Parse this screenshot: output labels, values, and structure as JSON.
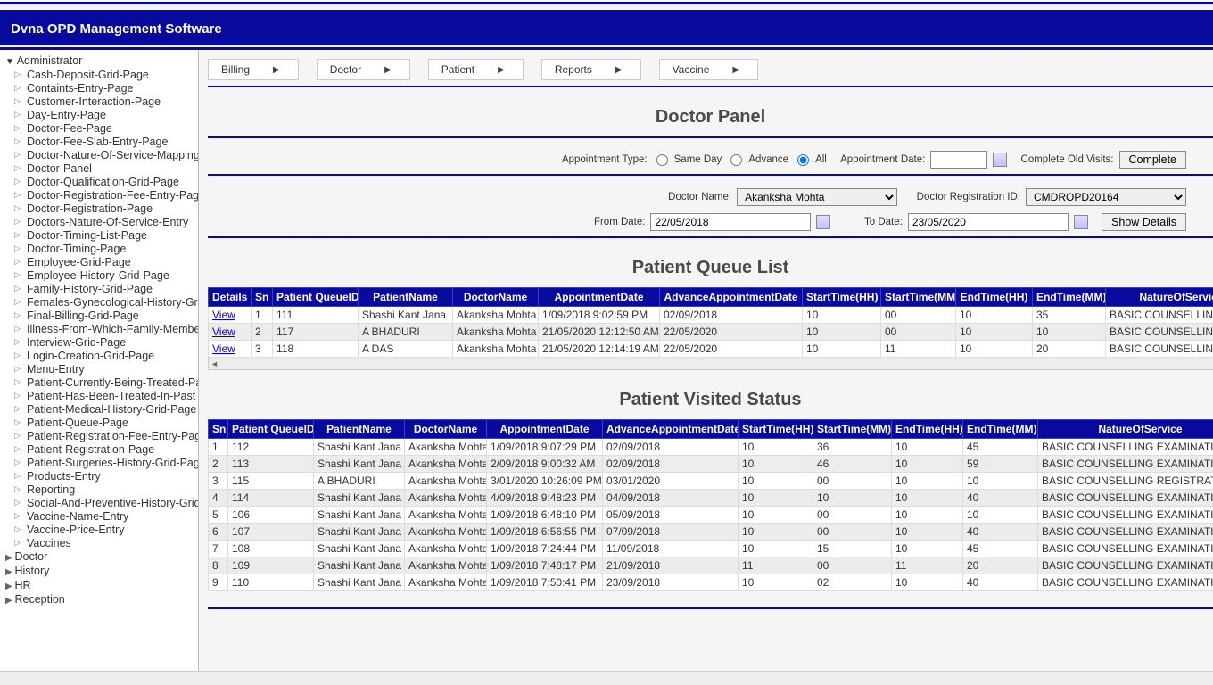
{
  "header": {
    "title": "Dvna OPD Management Software"
  },
  "sidebar": {
    "root": "Administrator",
    "items": [
      "Cash-Deposit-Grid-Page",
      "Containts-Entry-Page",
      "Customer-Interaction-Page",
      "Day-Entry-Page",
      "Doctor-Fee-Page",
      "Doctor-Fee-Slab-Entry-Page",
      "Doctor-Nature-Of-Service-Mapping",
      "Doctor-Panel",
      "Doctor-Qualification-Grid-Page",
      "Doctor-Registration-Fee-Entry-Page",
      "Doctor-Registration-Page",
      "Doctors-Nature-Of-Service-Entry",
      "Doctor-Timing-List-Page",
      "Doctor-Timing-Page",
      "Employee-Grid-Page",
      "Employee-History-Grid-Page",
      "Family-History-Grid-Page",
      "Females-Gynecological-History-Grid",
      "Final-Billing-Grid-Page",
      "Illness-From-Which-Family-Members",
      "Interview-Grid-Page",
      "Login-Creation-Grid-Page",
      "Menu-Entry",
      "Patient-Currently-Being-Treated-Page",
      "Patient-Has-Been-Treated-In-Past",
      "Patient-Medical-History-Grid-Page",
      "Patient-Queue-Page",
      "Patient-Registration-Fee-Entry-Page",
      "Patient-Registration-Page",
      "Patient-Surgeries-History-Grid-Page",
      "Products-Entry",
      "Reporting",
      "Social-And-Preventive-History-Grid",
      "Vaccine-Name-Entry",
      "Vaccine-Price-Entry",
      "Vaccines"
    ],
    "closed": [
      "Doctor",
      "History",
      "HR",
      "Reception"
    ]
  },
  "menubar": [
    "Billing",
    "Doctor",
    "Patient",
    "Reports",
    "Vaccine"
  ],
  "panel": {
    "title": "Doctor Panel",
    "labels": {
      "appt_type": "Appointment Type:",
      "same_day": "Same Day",
      "advance": "Advance",
      "all": "All",
      "appt_date": "Appointment Date:",
      "complete_old": "Complete Old Visits:",
      "complete_btn": "Complete",
      "doctor_name": "Doctor Name:",
      "doctor_reg": "Doctor Registration ID:",
      "from_date": "From Date:",
      "to_date": "To Date:",
      "show_details": "Show Details"
    },
    "values": {
      "doctor_name": "Akanksha Mohta",
      "doctor_reg": "CMDROPD20164",
      "from_date": "22/05/2018",
      "to_date": "23/05/2020",
      "appt_date": ""
    }
  },
  "queue": {
    "title": "Patient Queue List",
    "headers": [
      "Details",
      "Sn",
      "Patient QueueID",
      "PatientName",
      "DoctorName",
      "AppointmentDate",
      "AdvanceAppointmentDate",
      "StartTime(HH)",
      "StartTime(MM)",
      "EndTime(HH)",
      "EndTime(MM)",
      "NatureOfService"
    ],
    "view": "View",
    "rows": [
      {
        "sn": "1",
        "pqid": "111",
        "pname": "Shashi Kant Jana",
        "dname": "Akanksha Mohta",
        "appt": "1/09/2018 9:02:59 PM",
        "adv": "02/09/2018",
        "sh": "10",
        "sm": "00",
        "eh": "10",
        "em": "35",
        "nos": "BASIC COUNSELLING"
      },
      {
        "sn": "2",
        "pqid": "117",
        "pname": "A BHADURI",
        "dname": "Akanksha Mohta",
        "appt": "21/05/2020 12:12:50 AM",
        "adv": "22/05/2020",
        "sh": "10",
        "sm": "00",
        "eh": "10",
        "em": "10",
        "nos": "BASIC COUNSELLING"
      },
      {
        "sn": "3",
        "pqid": "118",
        "pname": "A DAS",
        "dname": "Akanksha Mohta",
        "appt": "21/05/2020 12:14:19 AM",
        "adv": "22/05/2020",
        "sh": "10",
        "sm": "11",
        "eh": "10",
        "em": "20",
        "nos": "BASIC COUNSELLING"
      }
    ]
  },
  "visited": {
    "title": "Patient Visited Status",
    "headers": [
      "Sn",
      "Patient QueueID",
      "PatientName",
      "DoctorName",
      "AppointmentDate",
      "AdvanceAppointmentDate",
      "StartTime(HH)",
      "StartTime(MM)",
      "EndTime(HH)",
      "EndTime(MM)",
      "NatureOfService"
    ],
    "rows": [
      {
        "sn": "1",
        "pqid": "112",
        "pname": "Shashi Kant Jana",
        "dname": "Akanksha Mohta",
        "appt": "1/09/2018 9:07:29 PM",
        "adv": "02/09/2018",
        "sh": "10",
        "sm": "36",
        "eh": "10",
        "em": "45",
        "nos": "BASIC COUNSELLING EXAMINATION"
      },
      {
        "sn": "2",
        "pqid": "113",
        "pname": "Shashi Kant Jana",
        "dname": "Akanksha Mohta",
        "appt": "2/09/2018 9:00:32 AM",
        "adv": "02/09/2018",
        "sh": "10",
        "sm": "46",
        "eh": "10",
        "em": "59",
        "nos": "BASIC COUNSELLING EXAMINATION"
      },
      {
        "sn": "3",
        "pqid": "115",
        "pname": "A BHADURI",
        "dname": "Akanksha Mohta",
        "appt": "3/01/2020 10:26:09 PM",
        "adv": "03/01/2020",
        "sh": "10",
        "sm": "00",
        "eh": "10",
        "em": "10",
        "nos": "BASIC COUNSELLING REGISTRATION"
      },
      {
        "sn": "4",
        "pqid": "114",
        "pname": "Shashi Kant Jana",
        "dname": "Akanksha Mohta",
        "appt": "4/09/2018 9:48:23 PM",
        "adv": "04/09/2018",
        "sh": "10",
        "sm": "10",
        "eh": "10",
        "em": "40",
        "nos": "BASIC COUNSELLING EXAMINATION"
      },
      {
        "sn": "5",
        "pqid": "106",
        "pname": "Shashi Kant Jana",
        "dname": "Akanksha Mohta",
        "appt": "1/09/2018 6:48:10 PM",
        "adv": "05/09/2018",
        "sh": "10",
        "sm": "00",
        "eh": "10",
        "em": "10",
        "nos": "BASIC COUNSELLING EXAMINATION"
      },
      {
        "sn": "6",
        "pqid": "107",
        "pname": "Shashi Kant Jana",
        "dname": "Akanksha Mohta",
        "appt": "1/09/2018 6:56:55 PM",
        "adv": "07/09/2018",
        "sh": "10",
        "sm": "00",
        "eh": "10",
        "em": "40",
        "nos": "BASIC COUNSELLING EXAMINATION"
      },
      {
        "sn": "7",
        "pqid": "108",
        "pname": "Shashi Kant Jana",
        "dname": "Akanksha Mohta",
        "appt": "1/09/2018 7:24:44 PM",
        "adv": "11/09/2018",
        "sh": "10",
        "sm": "15",
        "eh": "10",
        "em": "45",
        "nos": "BASIC COUNSELLING EXAMINATION"
      },
      {
        "sn": "8",
        "pqid": "109",
        "pname": "Shashi Kant Jana",
        "dname": "Akanksha Mohta",
        "appt": "1/09/2018 7:48:17 PM",
        "adv": "21/09/2018",
        "sh": "11",
        "sm": "00",
        "eh": "11",
        "em": "20",
        "nos": "BASIC COUNSELLING EXAMINATION"
      },
      {
        "sn": "9",
        "pqid": "110",
        "pname": "Shashi Kant Jana",
        "dname": "Akanksha Mohta",
        "appt": "1/09/2018 7:50:41 PM",
        "adv": "23/09/2018",
        "sh": "10",
        "sm": "02",
        "eh": "10",
        "em": "40",
        "nos": "BASIC COUNSELLING EXAMINATION"
      }
    ]
  }
}
